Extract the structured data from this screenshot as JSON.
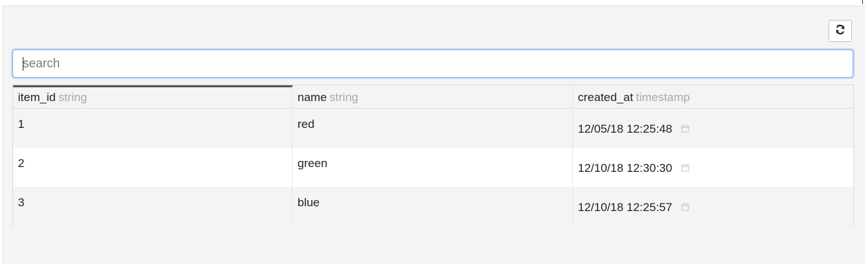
{
  "toolbar": {
    "refresh_icon": "refresh-icon"
  },
  "search": {
    "placeholder": "search",
    "value": ""
  },
  "table": {
    "columns": [
      {
        "name": "item_id",
        "type": "string"
      },
      {
        "name": "name",
        "type": "string"
      },
      {
        "name": "created_at",
        "type": "timestamp"
      }
    ],
    "rows": [
      {
        "item_id": "1",
        "name": "red",
        "created_at": "12/05/18 12:25:48"
      },
      {
        "item_id": "2",
        "name": "green",
        "created_at": "12/10/18 12:30:30"
      },
      {
        "item_id": "3",
        "name": "blue",
        "created_at": "12/10/18 12:25:57"
      }
    ],
    "timestamp_icon": "calendar-icon"
  },
  "colors": {
    "panel_bg": "#f4f4f4",
    "focus_border": "#7fb0ec",
    "type_hint": "#a9a9a9"
  }
}
